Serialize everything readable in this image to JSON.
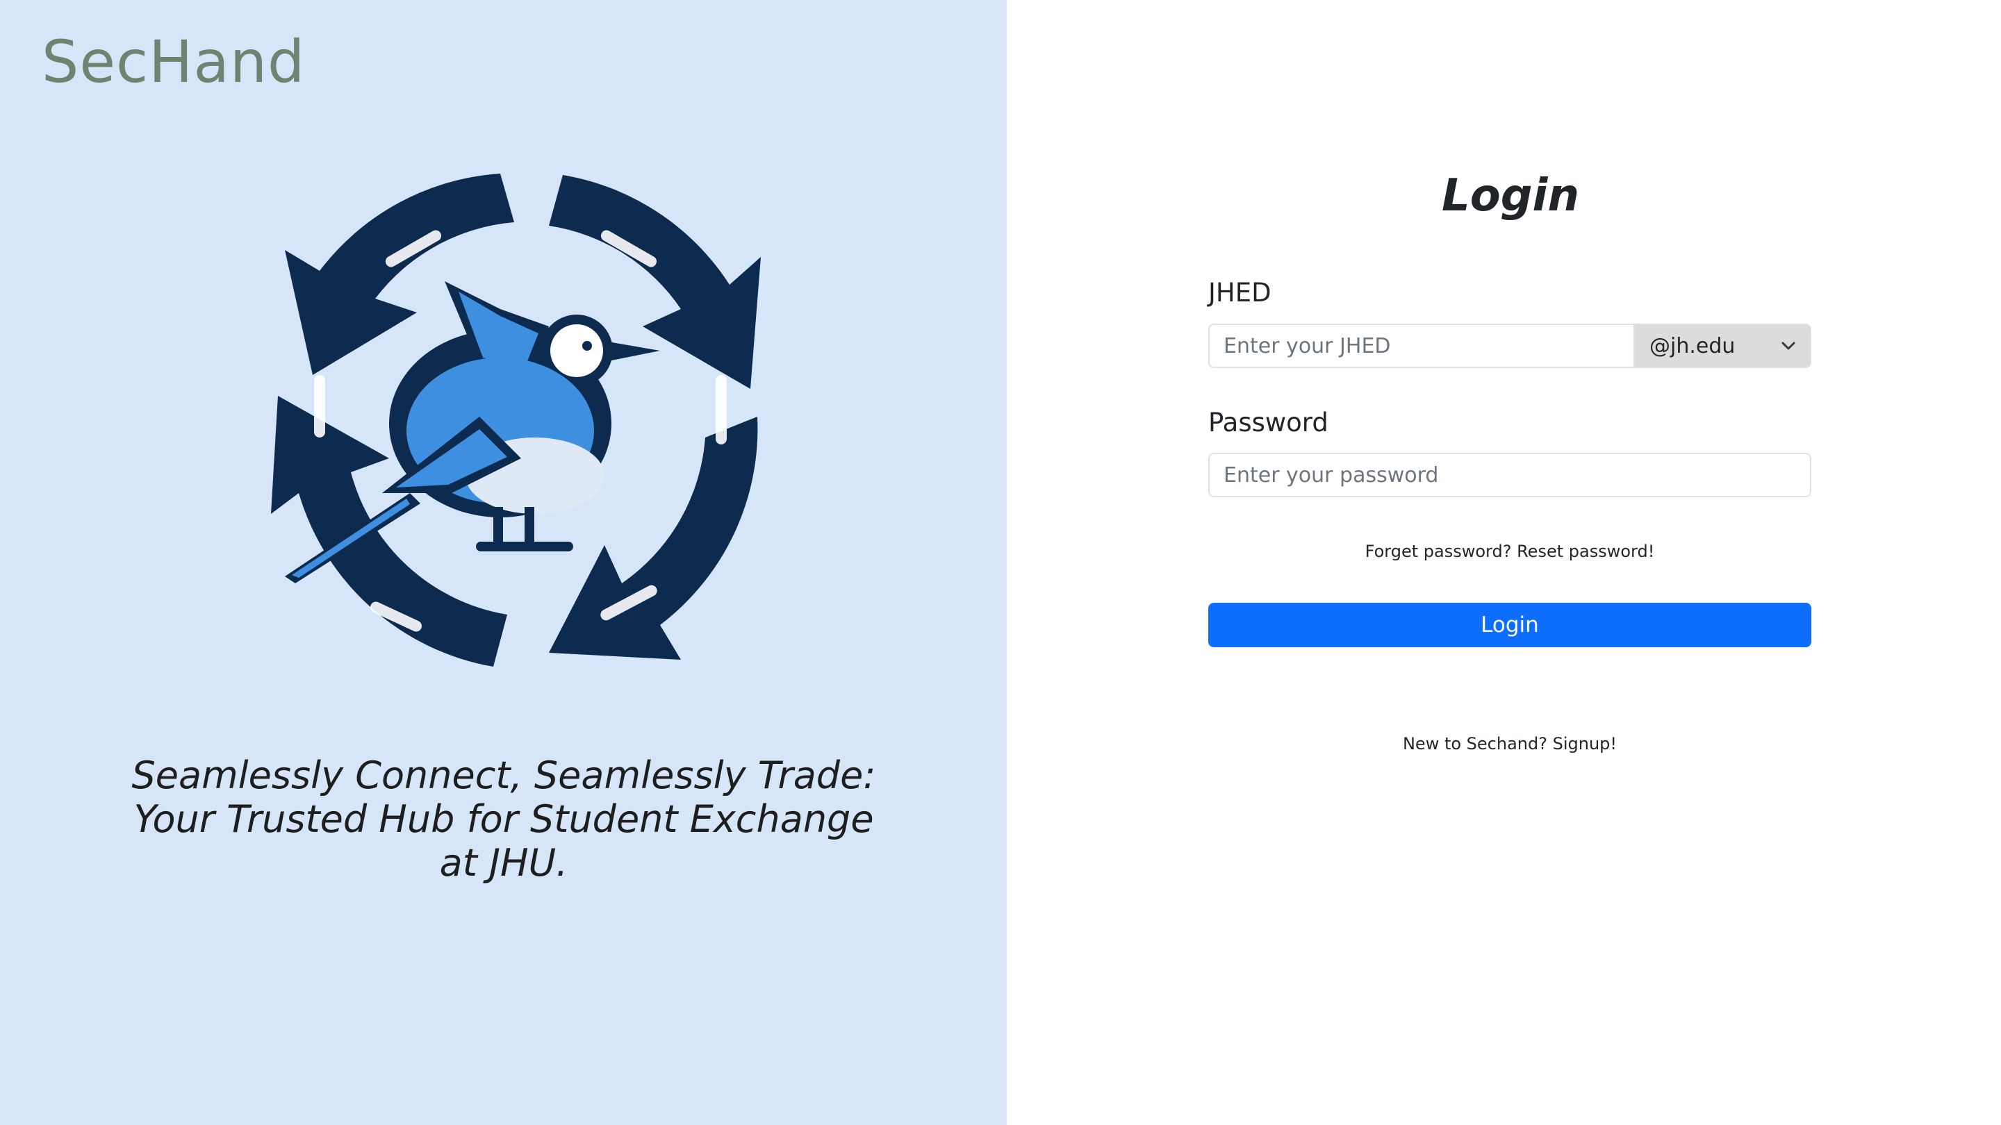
{
  "brand": {
    "name": "SecHand"
  },
  "hero": {
    "logo_icon": "blue-jay-recycle-icon",
    "tagline_line1": "Seamlessly Connect, Seamlessly Trade:",
    "tagline_line2": "Your Trusted Hub for Student Exchange",
    "tagline_line3": "at JHU."
  },
  "login": {
    "title": "Login",
    "jhed_label": "JHED",
    "jhed_placeholder": "Enter your JHED",
    "jhed_value": "",
    "domain_selected": "@jh.edu",
    "password_label": "Password",
    "password_placeholder": "Enter your password",
    "password_value": "",
    "forgot_text": "Forget password? Reset password!",
    "submit_label": "Login",
    "signup_text": "New to Sechand? Signup!"
  },
  "colors": {
    "left_panel": "#d6e5f8",
    "primary_button": "#0d6efd",
    "brand_text": "#6f8470",
    "logo_dark": "#0d2a4f",
    "logo_blue": "#3f8fe0"
  }
}
